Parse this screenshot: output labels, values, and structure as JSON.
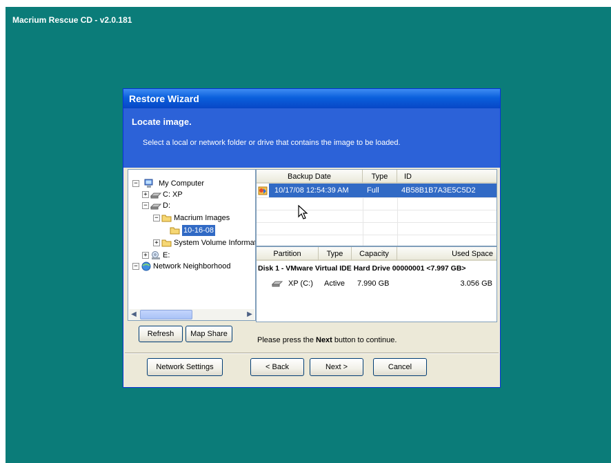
{
  "desktop": {
    "title": "Macrium Rescue CD - v2.0.181"
  },
  "window": {
    "title": "Restore Wizard"
  },
  "header": {
    "title": "Locate image.",
    "description": "Select a local or network folder or drive that contains the image to be loaded."
  },
  "tree": {
    "my_computer": "My Computer",
    "c_drive": "C: XP",
    "d_drive": "D:",
    "macrium_images": "Macrium Images",
    "dated_folder": "10-16-08",
    "system_volume": "System Volume Information",
    "e_drive": "E:",
    "network": "Network Neighborhood"
  },
  "backup_list": {
    "columns": [
      "Backup Date",
      "Type",
      "ID"
    ],
    "rows": [
      {
        "date": "10/17/08 12:54:39 AM",
        "type": "Full",
        "id": "4B58B1B7A3E5C5D2"
      }
    ]
  },
  "partition_list": {
    "columns": [
      "Partition",
      "Type",
      "Capacity",
      "Used Space"
    ],
    "disk_label": "Disk 1 - VMware Virtual IDE Hard Drive 00000001  <7.997 GB>",
    "rows": [
      {
        "partition": "XP (C:)",
        "type": "Active",
        "capacity": "7.990 GB",
        "used": "3.056 GB"
      }
    ]
  },
  "buttons": {
    "refresh": "Refresh",
    "map_share": "Map Share",
    "network_settings": "Network Settings",
    "back": "< Back",
    "next": "Next >",
    "cancel": "Cancel"
  },
  "message": {
    "prefix": "Please press the",
    "bold": "Next",
    "suffix": "button to continue."
  },
  "colors": {
    "desktop": "#0b7c79",
    "header": "#2c62d8",
    "selection": "#316ac5",
    "dialog": "#ece9d8"
  }
}
